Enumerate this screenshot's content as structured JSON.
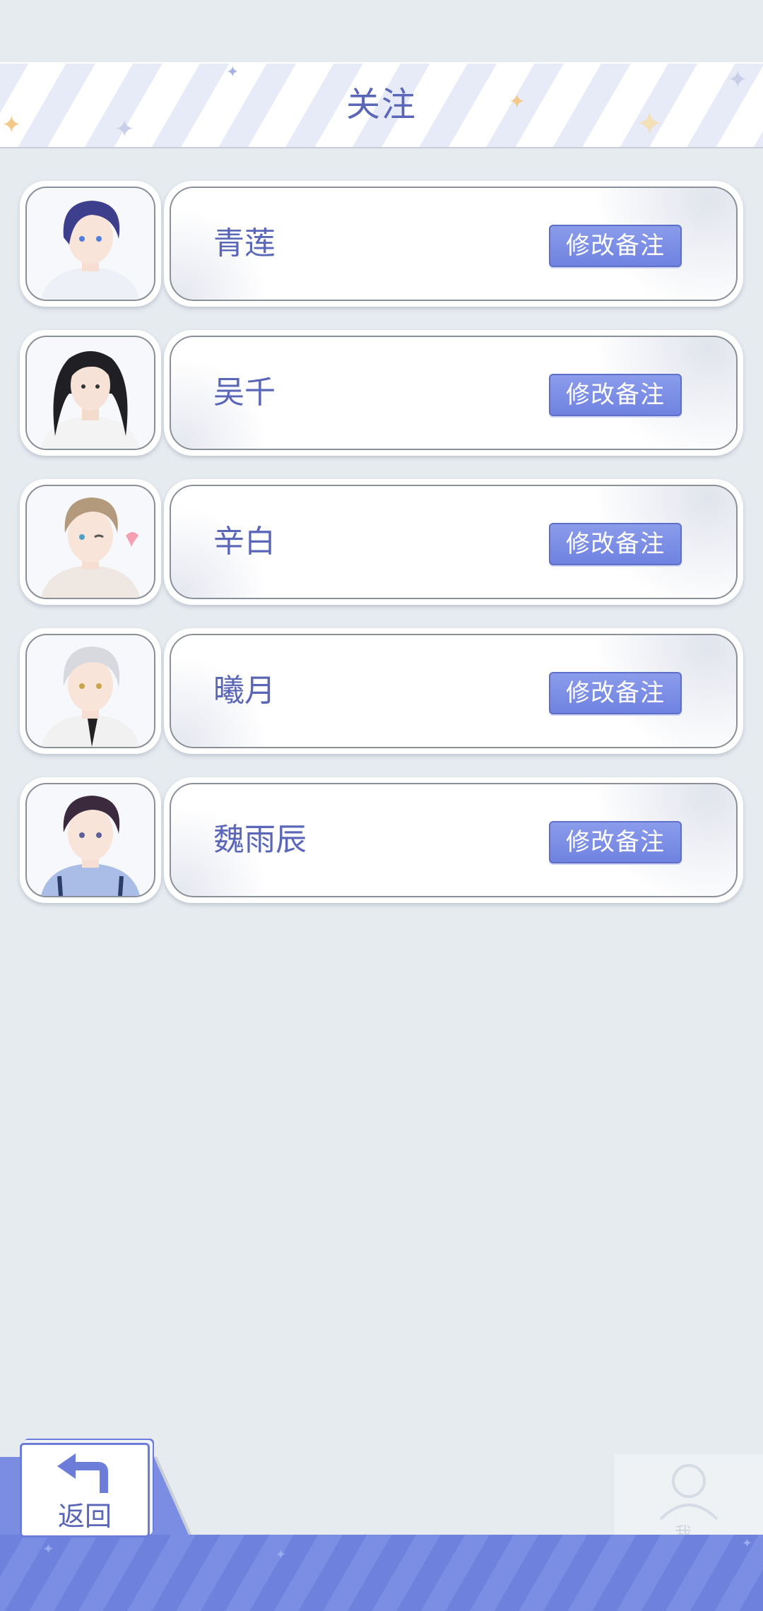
{
  "header": {
    "title": "关注"
  },
  "follow_list": [
    {
      "name": "青莲",
      "edit_label": "修改备注",
      "avatar": "avatar-qinglian",
      "hair_color": "#3e3f8c"
    },
    {
      "name": "吴千",
      "edit_label": "修改备注",
      "avatar": "avatar-wuqian",
      "hair_color": "#1f1f24"
    },
    {
      "name": "辛白",
      "edit_label": "修改备注",
      "avatar": "avatar-xinbai",
      "hair_color": "#b39a7c"
    },
    {
      "name": "曦月",
      "edit_label": "修改备注",
      "avatar": "avatar-xiyue",
      "hair_color": "#d7d9df"
    },
    {
      "name": "魏雨辰",
      "edit_label": "修改备注",
      "avatar": "avatar-weiyuchen",
      "hair_color": "#3b2a3e"
    }
  ],
  "bottom_nav": {
    "back_label": "返回",
    "me_label": "我"
  },
  "colors": {
    "accent": "#6f82e0",
    "text": "#5a66b8",
    "background": "#e6ebf0"
  }
}
